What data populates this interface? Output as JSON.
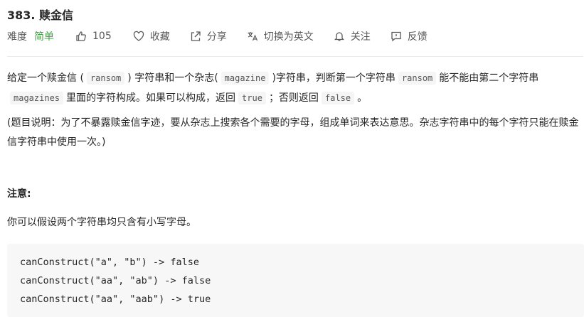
{
  "problem": {
    "title": "383. 赎金信",
    "difficulty_label": "难度",
    "difficulty_value": "简单",
    "likes": "105",
    "actions": {
      "favorite": "收藏",
      "share": "分享",
      "translate": "切换为英文",
      "follow": "关注",
      "feedback": "反馈"
    }
  },
  "description": {
    "p1_a": "给定一个赎金信 (",
    "p1_code1": "ransom",
    "p1_b": ") 字符串和一个杂志(",
    "p1_code2": "magazine",
    "p1_c": ")字符串，判断第一个字符串",
    "p1_code3": "ransom",
    "p1_d": "能不能由第二个字符串",
    "p1_code4": "magazines",
    "p1_e": "里面的字符构成。如果可以构成，返回",
    "p1_code5": "true",
    "p1_f": "；否则返回",
    "p1_code6": "false",
    "p1_g": "。",
    "p2": "(题目说明：为了不暴露赎金信字迹，要从杂志上搜索各个需要的字母，组成单词来表达意思。杂志字符串中的每个字符只能在赎金信字符串中使用一次。)"
  },
  "note": {
    "title": "注意:",
    "text": "你可以假设两个字符串均只含有小写字母。"
  },
  "code_block": {
    "lines": [
      "canConstruct(\"a\", \"b\") -> false",
      "canConstruct(\"aa\", \"ab\") -> false",
      "canConstruct(\"aa\", \"aab\") -> true"
    ]
  },
  "icons": {
    "like": "thumbs-up-icon",
    "favorite": "heart-icon",
    "share": "share-icon",
    "translate": "translate-icon",
    "follow": "bell-icon",
    "feedback": "feedback-icon"
  }
}
